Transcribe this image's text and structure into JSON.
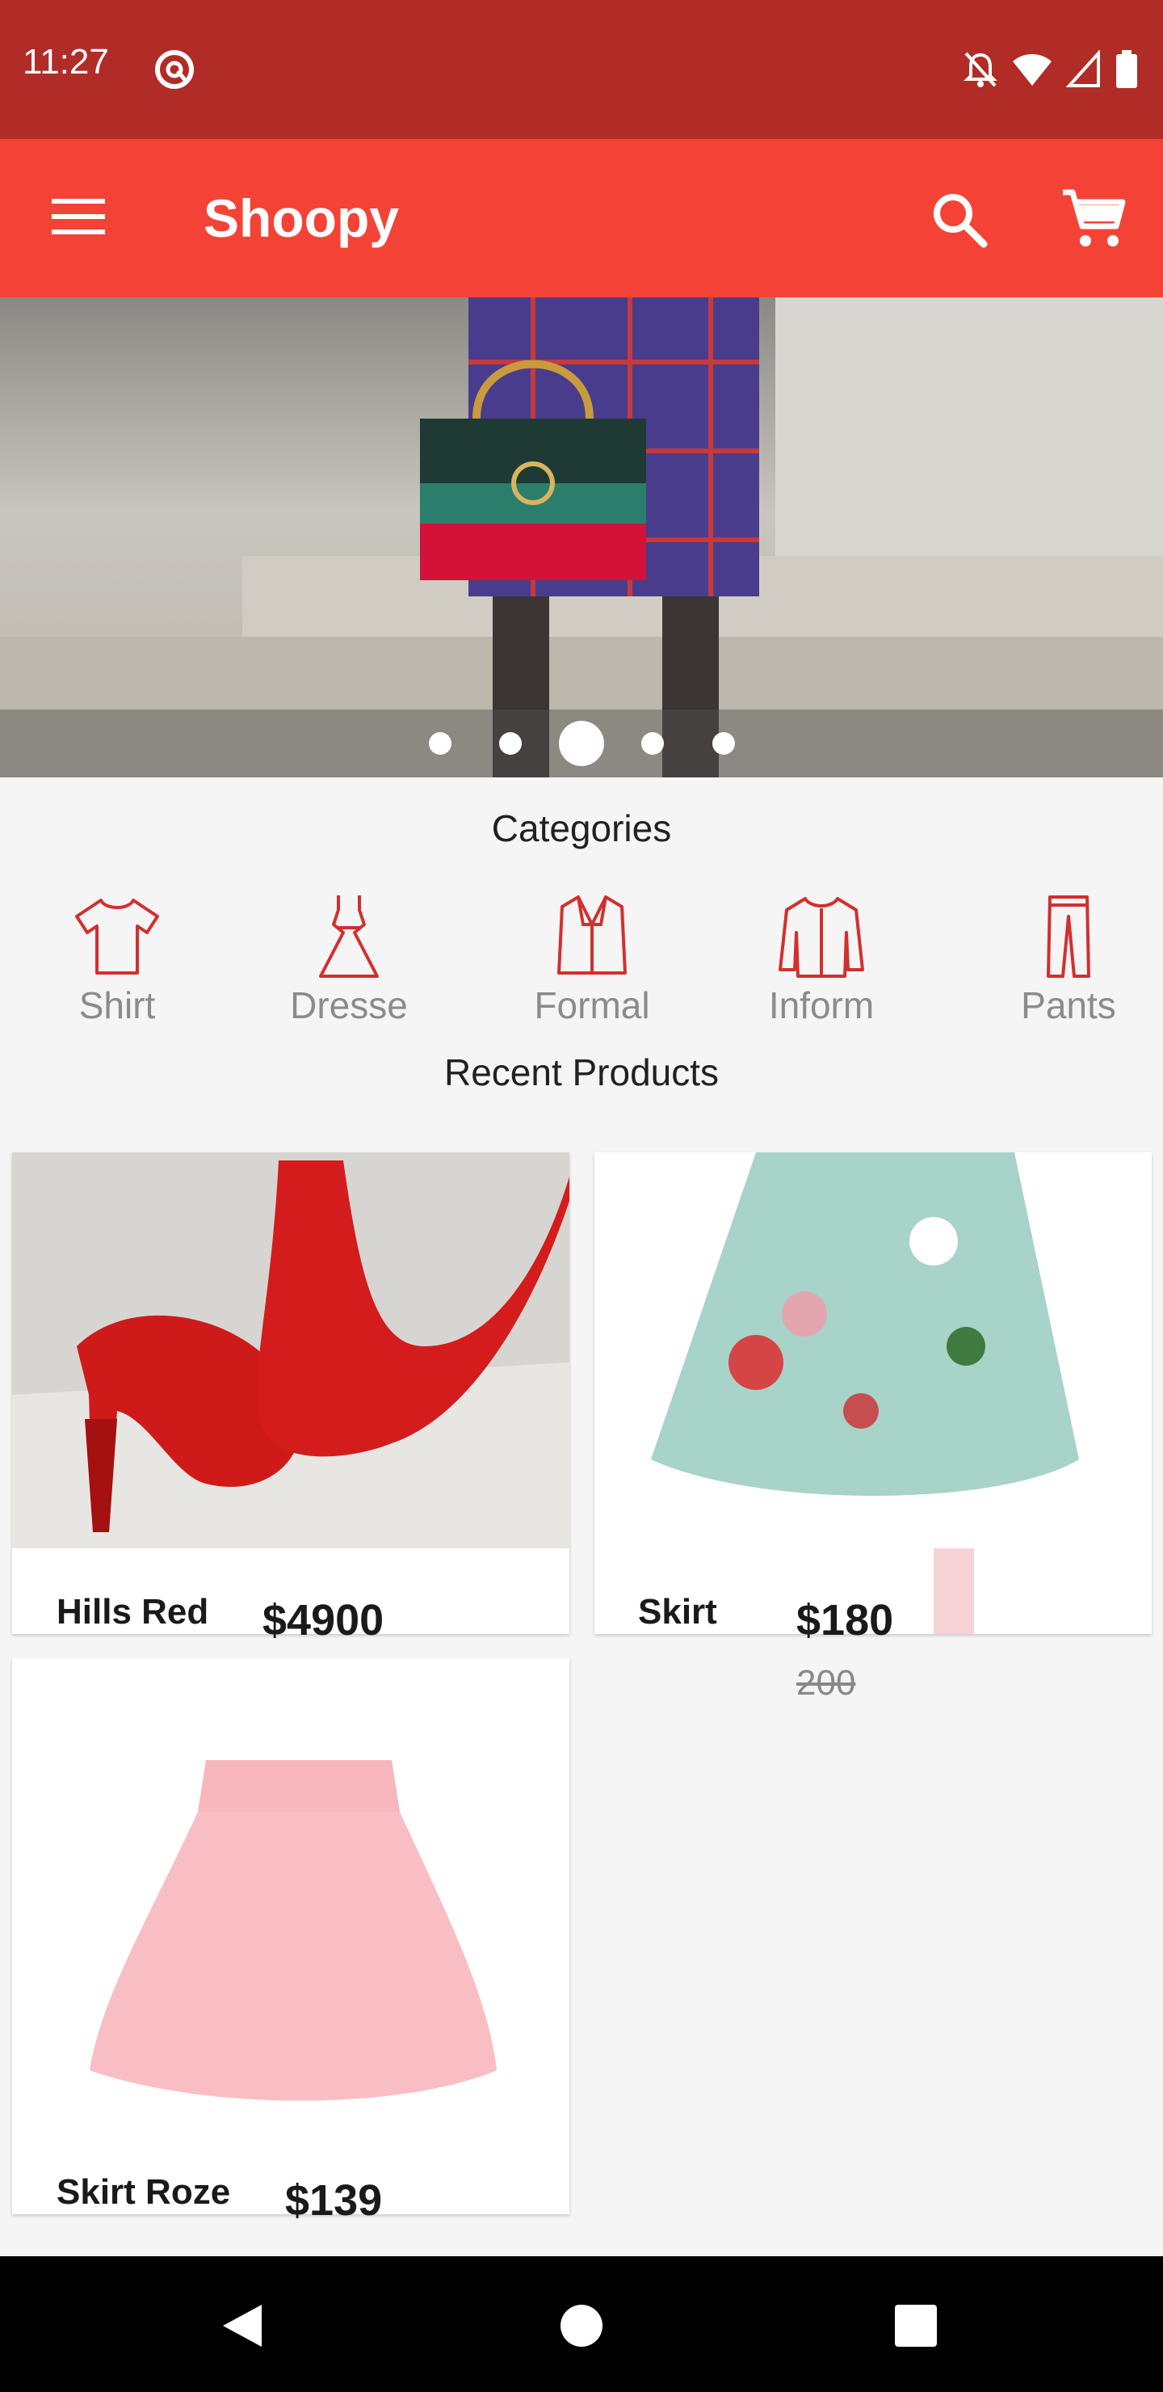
{
  "status_bar": {
    "time": "11:27"
  },
  "app_bar": {
    "title": "Shoopy",
    "menu_icon": "menu-icon",
    "search_icon": "search-icon",
    "cart_icon": "cart-icon"
  },
  "carousel": {
    "dots": 5,
    "active_index": 2
  },
  "categories": {
    "title": "Categories",
    "items": [
      {
        "label": "Shirt",
        "icon": "shirt-icon"
      },
      {
        "label": "Dresse",
        "icon": "dress-icon"
      },
      {
        "label": "Formal",
        "icon": "formal-icon"
      },
      {
        "label": "Inform",
        "icon": "jacket-icon"
      },
      {
        "label": "Pants",
        "icon": "pants-icon"
      }
    ]
  },
  "recent": {
    "title": "Recent Products",
    "products": [
      {
        "name": "Hills Red",
        "price": "$4900",
        "old_price": ""
      },
      {
        "name": "Skirt",
        "price": "$180",
        "old_price": "200"
      },
      {
        "name": "Skirt Roze",
        "price": "$139",
        "old_price": ""
      }
    ]
  },
  "colors": {
    "accent": "#f44336",
    "status": "#b12c27",
    "icon_red": "#d32f2f"
  }
}
